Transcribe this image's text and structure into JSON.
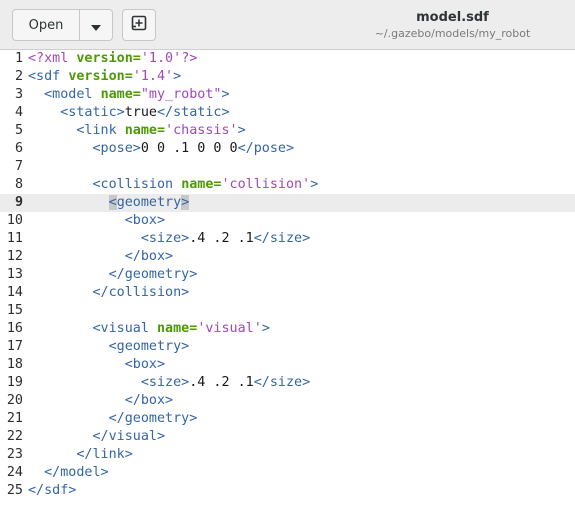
{
  "header": {
    "open_label": "Open",
    "title": "model.sdf",
    "subtitle": "~/.gazebo/models/my_robot"
  },
  "editor": {
    "current_line": 9,
    "lines": [
      {
        "n": "1",
        "indent": "",
        "parts": [
          {
            "t": "<?xml ",
            "c": "pi"
          },
          {
            "t": "version=",
            "c": "attr"
          },
          {
            "t": "'1.0'",
            "c": "str"
          },
          {
            "t": "?>",
            "c": "pi"
          }
        ]
      },
      {
        "n": "2",
        "indent": "",
        "parts": [
          {
            "t": "<sdf ",
            "c": "tag"
          },
          {
            "t": "version=",
            "c": "attr"
          },
          {
            "t": "'1.4'",
            "c": "str"
          },
          {
            "t": ">",
            "c": "tag"
          }
        ]
      },
      {
        "n": "3",
        "indent": "  ",
        "parts": [
          {
            "t": "<model ",
            "c": "tag"
          },
          {
            "t": "name=",
            "c": "attr"
          },
          {
            "t": "\"my_robot\"",
            "c": "str"
          },
          {
            "t": ">",
            "c": "tag"
          }
        ]
      },
      {
        "n": "4",
        "indent": "    ",
        "parts": [
          {
            "t": "<static>",
            "c": "tag"
          },
          {
            "t": "true",
            "c": "plain"
          },
          {
            "t": "</static>",
            "c": "tag"
          }
        ]
      },
      {
        "n": "5",
        "indent": "      ",
        "parts": [
          {
            "t": "<link ",
            "c": "tag"
          },
          {
            "t": "name=",
            "c": "attr"
          },
          {
            "t": "'chassis'",
            "c": "str"
          },
          {
            "t": ">",
            "c": "tag"
          }
        ]
      },
      {
        "n": "6",
        "indent": "        ",
        "parts": [
          {
            "t": "<pose>",
            "c": "tag"
          },
          {
            "t": "0 0 .1 0 0 0",
            "c": "plain"
          },
          {
            "t": "</pose>",
            "c": "tag"
          }
        ]
      },
      {
        "n": "7",
        "indent": "",
        "parts": []
      },
      {
        "n": "8",
        "indent": "        ",
        "parts": [
          {
            "t": "<collision ",
            "c": "tag"
          },
          {
            "t": "name=",
            "c": "attr"
          },
          {
            "t": "'collision'",
            "c": "str"
          },
          {
            "t": ">",
            "c": "tag"
          }
        ]
      },
      {
        "n": "9",
        "indent": "          ",
        "parts": [
          {
            "t": "<",
            "c": "tag hl"
          },
          {
            "t": "geometry",
            "c": "tag"
          },
          {
            "t": ">",
            "c": "tag hl"
          }
        ]
      },
      {
        "n": "10",
        "indent": "            ",
        "parts": [
          {
            "t": "<box>",
            "c": "tag"
          }
        ]
      },
      {
        "n": "11",
        "indent": "              ",
        "parts": [
          {
            "t": "<size>",
            "c": "tag"
          },
          {
            "t": ".4 .2 .1",
            "c": "plain"
          },
          {
            "t": "</size>",
            "c": "tag"
          }
        ]
      },
      {
        "n": "12",
        "indent": "            ",
        "parts": [
          {
            "t": "</box>",
            "c": "tag"
          }
        ]
      },
      {
        "n": "13",
        "indent": "          ",
        "parts": [
          {
            "t": "</geometry>",
            "c": "tag"
          }
        ]
      },
      {
        "n": "14",
        "indent": "        ",
        "parts": [
          {
            "t": "</collision>",
            "c": "tag"
          }
        ]
      },
      {
        "n": "15",
        "indent": "",
        "parts": []
      },
      {
        "n": "16",
        "indent": "        ",
        "parts": [
          {
            "t": "<visual ",
            "c": "tag"
          },
          {
            "t": "name=",
            "c": "attr"
          },
          {
            "t": "'visual'",
            "c": "str"
          },
          {
            "t": ">",
            "c": "tag"
          }
        ]
      },
      {
        "n": "17",
        "indent": "          ",
        "parts": [
          {
            "t": "<geometry>",
            "c": "tag"
          }
        ]
      },
      {
        "n": "18",
        "indent": "            ",
        "parts": [
          {
            "t": "<box>",
            "c": "tag"
          }
        ]
      },
      {
        "n": "19",
        "indent": "              ",
        "parts": [
          {
            "t": "<size>",
            "c": "tag"
          },
          {
            "t": ".4 .2 .1",
            "c": "plain"
          },
          {
            "t": "</size>",
            "c": "tag"
          }
        ]
      },
      {
        "n": "20",
        "indent": "            ",
        "parts": [
          {
            "t": "</box>",
            "c": "tag"
          }
        ]
      },
      {
        "n": "21",
        "indent": "          ",
        "parts": [
          {
            "t": "</geometry>",
            "c": "tag"
          }
        ]
      },
      {
        "n": "22",
        "indent": "        ",
        "parts": [
          {
            "t": "</visual>",
            "c": "tag"
          }
        ]
      },
      {
        "n": "23",
        "indent": "      ",
        "parts": [
          {
            "t": "</link>",
            "c": "tag"
          }
        ]
      },
      {
        "n": "24",
        "indent": "  ",
        "parts": [
          {
            "t": "</model>",
            "c": "tag"
          }
        ]
      },
      {
        "n": "25",
        "indent": "",
        "parts": [
          {
            "t": "</sdf>",
            "c": "tag"
          }
        ]
      }
    ]
  }
}
